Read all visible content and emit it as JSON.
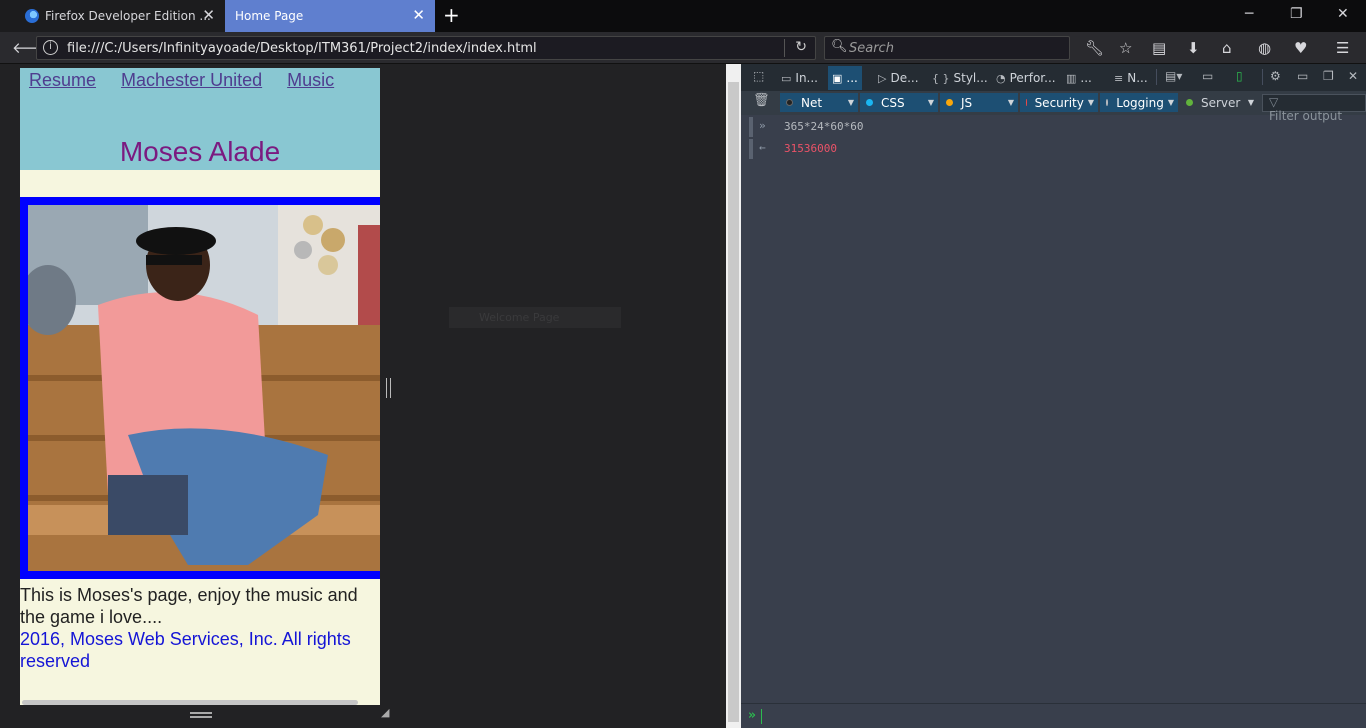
{
  "browser": {
    "tabs": [
      {
        "title": "Firefox Developer Edition ...",
        "active": false
      },
      {
        "title": "Home Page",
        "active": true
      }
    ],
    "url": "file:///C:/Users/Infinityayoade/Desktop/ITM361/Project2/index/index.html",
    "search_placeholder": "Search"
  },
  "page": {
    "nav_links": [
      "Resume",
      "Machester United",
      "Music"
    ],
    "title": "Moses Alade",
    "intro": "This is Moses's page, enjoy the music and the game i love....",
    "footer": "2016, Moses Web Services, Inc. All rights reserved",
    "colors": {
      "header": "#89c7d2",
      "title": "#7b1a80",
      "frame": "#0000ff",
      "footer": "#1515d6"
    }
  },
  "ghost_label": "Welcome Page",
  "devtools": {
    "tabs": [
      "In...",
      "...",
      "De...",
      "Styl...",
      "Perfor...",
      "...",
      "N..."
    ],
    "filters": [
      {
        "label": "Net",
        "color": "#222222",
        "on": true
      },
      {
        "label": "CSS",
        "color": "#1ab6f2",
        "on": true
      },
      {
        "label": "JS",
        "color": "#f9a70b",
        "on": true
      },
      {
        "label": "Security",
        "color": "#ee4a4a",
        "on": true
      },
      {
        "label": "Logging",
        "color": "#b6babf",
        "on": true
      },
      {
        "label": "Server",
        "color": "#61b33c",
        "on": false
      }
    ],
    "filter_placeholder": "Filter output",
    "console": {
      "input": "365*24*60*60",
      "output": "31536000",
      "output_color": "#eb5368"
    }
  }
}
